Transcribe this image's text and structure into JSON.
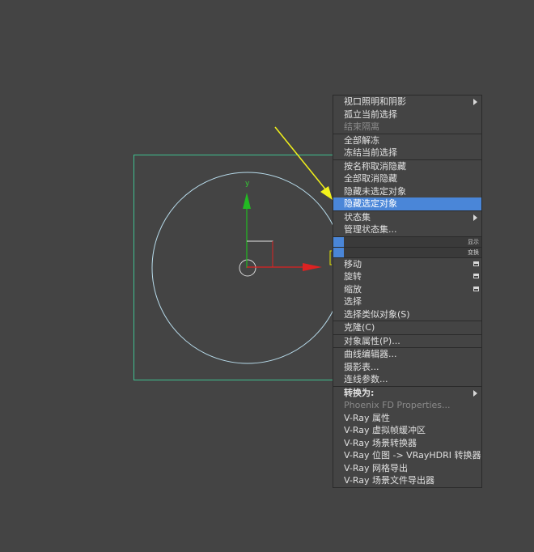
{
  "viewport": {
    "gizmo": {
      "y_label": "y"
    },
    "colors": {
      "background": "#444444",
      "selection_box": "#3fbf8f",
      "circle": "#b8dcec",
      "y_axis": "#22bb22",
      "x_axis": "#dd2222",
      "annotation_arrow": "#f2f21a"
    }
  },
  "menu": {
    "groups": [
      [
        {
          "label": "视口照明和阴影",
          "disabled": false,
          "submenu": true
        },
        {
          "label": "孤立当前选择",
          "disabled": false
        },
        {
          "label": "结束隔离",
          "disabled": true
        }
      ],
      [
        {
          "label": "全部解冻",
          "disabled": false
        },
        {
          "label": "冻结当前选择",
          "disabled": false
        }
      ],
      [
        {
          "label": "按名称取消隐藏",
          "disabled": false
        },
        {
          "label": "全部取消隐藏",
          "disabled": false
        },
        {
          "label": "隐藏未选定对象",
          "disabled": false
        },
        {
          "label": "隐藏选定对象",
          "disabled": false,
          "highlighted": true
        }
      ],
      [
        {
          "label": "状态集",
          "disabled": false,
          "submenu": true
        },
        {
          "label": "管理状态集...",
          "disabled": false
        }
      ]
    ],
    "quad_labels": {
      "display": "显示",
      "transform": "变换"
    },
    "transform_items": [
      {
        "label": "移动",
        "disabled": false,
        "box": true
      },
      {
        "label": "旋转",
        "disabled": false,
        "box": true
      },
      {
        "label": "缩放",
        "disabled": false,
        "box": true
      },
      {
        "label": "选择",
        "disabled": false
      },
      {
        "label": "选择类似对象(S)",
        "disabled": false
      }
    ],
    "lower_groups": [
      [
        {
          "label": "克隆(C)",
          "disabled": false
        }
      ],
      [
        {
          "label": "对象属性(P)...",
          "disabled": false
        }
      ],
      [
        {
          "label": "曲线编辑器...",
          "disabled": false
        },
        {
          "label": "摄影表...",
          "disabled": false
        },
        {
          "label": "连线参数...",
          "disabled": false
        }
      ],
      [
        {
          "label": "转换为:",
          "disabled": false,
          "submenu": true,
          "bold": true
        },
        {
          "label": "Phoenix FD Properties...",
          "disabled": true
        },
        {
          "label": "V-Ray 属性",
          "disabled": false
        },
        {
          "label": "V-Ray 虚拟帧缓冲区",
          "disabled": false
        },
        {
          "label": "V-Ray 场景转换器",
          "disabled": false
        },
        {
          "label": "V-Ray 位图 -> VRayHDRI 转换器",
          "disabled": false
        },
        {
          "label": "V-Ray 网格导出",
          "disabled": false
        },
        {
          "label": "V-Ray 场景文件导出器",
          "disabled": false
        }
      ]
    ]
  }
}
